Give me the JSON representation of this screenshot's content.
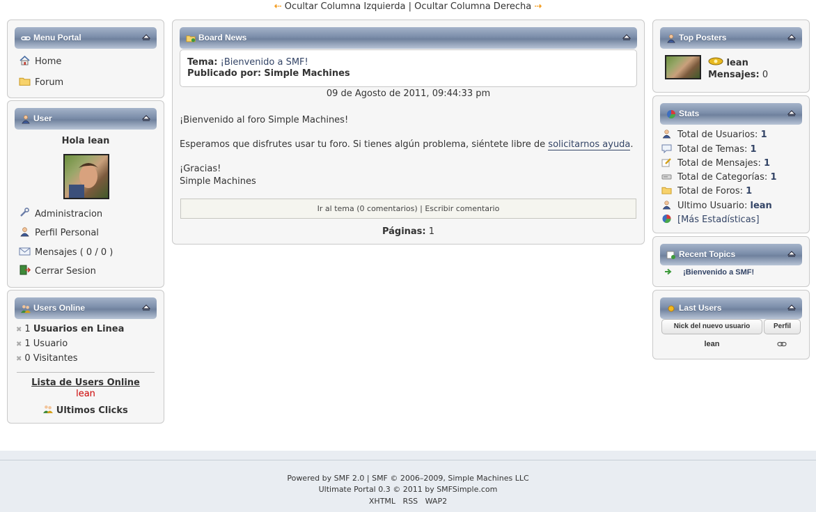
{
  "topbar": {
    "hide_left": "Ocultar Columna Izquierda",
    "separator": " | ",
    "hide_right": "Ocultar Columna Derecha"
  },
  "menu_portal": {
    "title": "Menu Portal",
    "items": [
      {
        "label": "Home",
        "icon": "home-icon"
      },
      {
        "label": "Forum",
        "icon": "folder-icon"
      }
    ]
  },
  "user": {
    "title": "User",
    "greeting": "Hola lean",
    "links": [
      {
        "label": "Administracion",
        "icon": "wrench-icon"
      },
      {
        "label": "Perfil Personal",
        "icon": "user-icon"
      },
      {
        "label": "Mensajes ( 0 / 0 )",
        "icon": "envelope-icon"
      },
      {
        "label": "Cerrar Sesion",
        "icon": "logout-icon"
      }
    ]
  },
  "users_online": {
    "title": "Users Online",
    "total_count": "1",
    "total_label": "Usuarios en Linea",
    "users_line": "1 Usuario",
    "visitors_line": "0 Visitantes",
    "list_title": "Lista de Users Online",
    "online_user": "lean",
    "last_clicks": "Ultimos Clicks"
  },
  "board_news": {
    "title": "Board News",
    "topic_label": "Tema:",
    "topic_value": "¡Bienvenido a SMF!",
    "posted_label": "Publicado por:",
    "posted_value": "Simple Machines",
    "date": "09 de Agosto de 2011, 09:44:33 pm",
    "body_line1": "¡Bienvenido al foro Simple Machines!",
    "body_line2_before": "Esperamos que disfrutes usar tu foro.  Si tienes algún problema, siéntete libre de ",
    "body_link": "solicitarnos ayuda",
    "body_line2_after": ".",
    "body_line3": "¡Gracias!",
    "body_line4": "Simple Machines",
    "action_read": "Ir al tema (0 comentarios)",
    "action_sep": " | ",
    "action_write": "Escribir comentario",
    "pages_label": "Páginas:",
    "pages_value": "1"
  },
  "top_posters": {
    "title": "Top Posters",
    "name": "lean",
    "messages_label": "Mensajes:",
    "messages_value": "0"
  },
  "stats": {
    "title": "Stats",
    "rows": [
      {
        "label": "Total de Usuarios:",
        "value": "1",
        "icon": "user-icon"
      },
      {
        "label": "Total de Temas:",
        "value": "1",
        "icon": "speech-icon"
      },
      {
        "label": "Total de Mensajes:",
        "value": "1",
        "icon": "pencil-icon"
      },
      {
        "label": "Total de Categorías:",
        "value": "1",
        "icon": "drive-icon"
      },
      {
        "label": "Total de Foros:",
        "value": "1",
        "icon": "folder-icon"
      },
      {
        "label": "Ultimo Usuario:",
        "value": "lean",
        "icon": "user-icon"
      }
    ],
    "more": "[Más Estadísticas]"
  },
  "recent_topics": {
    "title": "Recent Topics",
    "items": [
      "¡Bienvenido a SMF!"
    ]
  },
  "last_users": {
    "title": "Last Users",
    "col_nick": "Nick del nuevo usuario",
    "col_profile": "Perfil",
    "rows": [
      {
        "nick": "lean"
      }
    ]
  },
  "footer": {
    "line1": "Powered by SMF 2.0 | SMF © 2006–2009, Simple Machines LLC",
    "line2": "Ultimate Portal 0.3 © 2011 by SMFSimple.com",
    "links": [
      "XHTML",
      "RSS",
      "WAP2"
    ]
  },
  "colors": {
    "header_gradient_top": "#a4b3c9",
    "header_gradient_bottom": "#6f819d",
    "link": "#334466",
    "online_user": "#cc0000",
    "arrow": "#f39c1f"
  }
}
